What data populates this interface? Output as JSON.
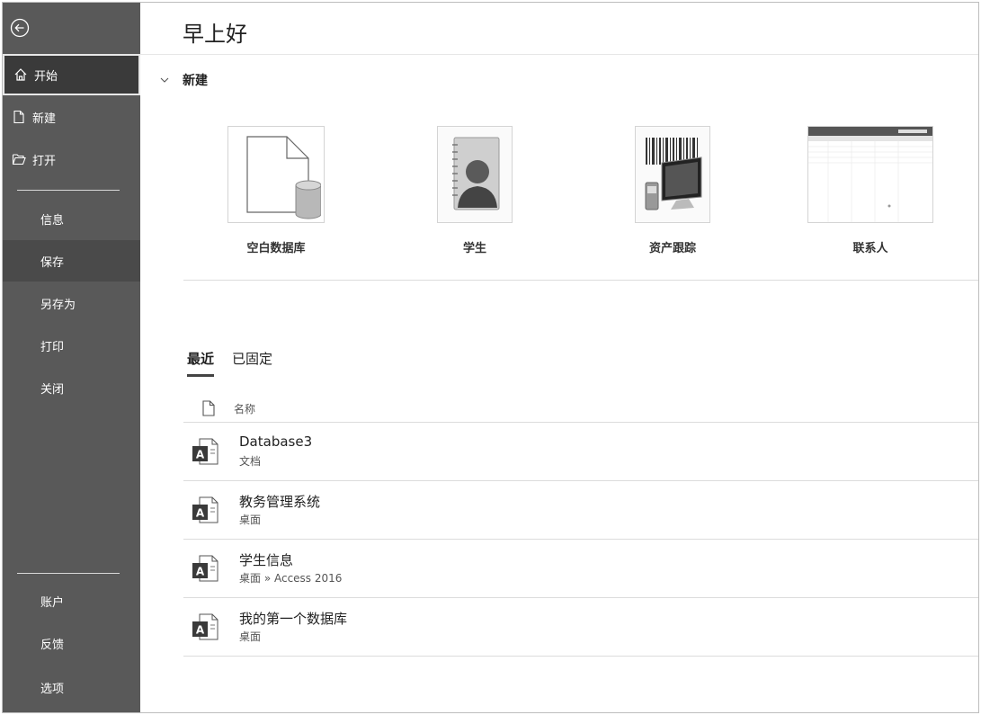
{
  "sidebar": {
    "nav": {
      "home": "开始",
      "new": "新建",
      "open": "打开",
      "info": "信息",
      "save": "保存",
      "save_as": "另存为",
      "print": "打印",
      "close": "关闭",
      "account": "账户",
      "feedback": "反馈",
      "options": "选项"
    }
  },
  "header": {
    "greeting": "早上好"
  },
  "new_section": {
    "title": "新建",
    "templates": [
      {
        "label": "空白数据库",
        "icon": "blank-database-icon"
      },
      {
        "label": "学生",
        "icon": "student-icon"
      },
      {
        "label": "资产跟踪",
        "icon": "asset-tracking-icon"
      },
      {
        "label": "联系人",
        "icon": "contacts-list-icon"
      }
    ]
  },
  "recent": {
    "tabs": {
      "recent": "最近",
      "pinned": "已固定"
    },
    "column_name": "名称",
    "files": [
      {
        "name": "Database3",
        "path": "文档"
      },
      {
        "name": "教务管理系统",
        "path": "桌面"
      },
      {
        "name": "学生信息",
        "path": "桌面 » Access 2016"
      },
      {
        "name": "我的第一个数据库",
        "path": "桌面"
      }
    ]
  },
  "colors": {
    "sidebar": "#595959",
    "sidebar_active": "#3a3a3a",
    "divider": "#dcdcdc"
  }
}
